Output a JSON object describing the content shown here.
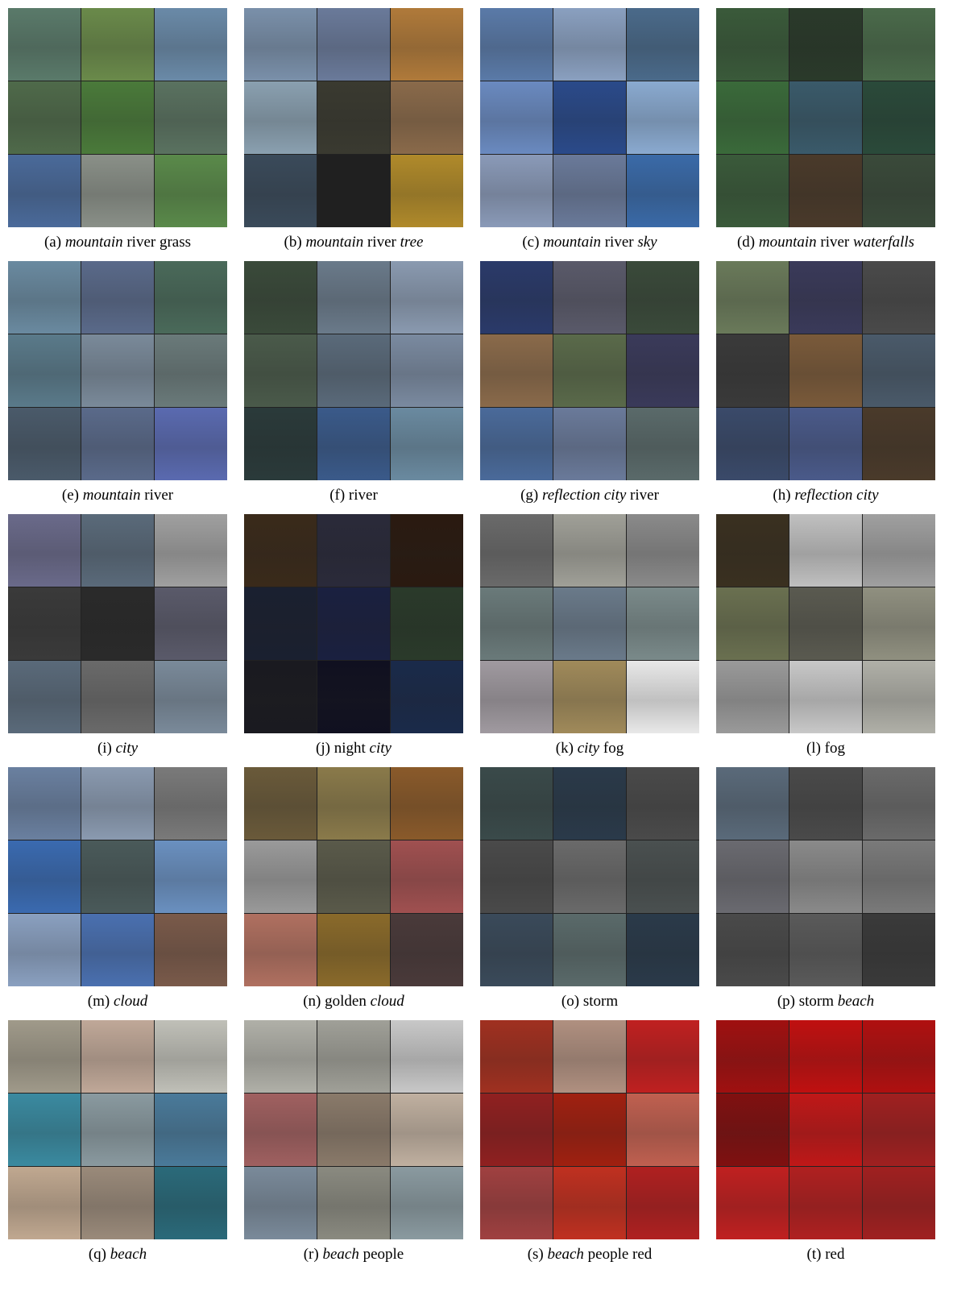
{
  "panels": [
    {
      "label": "(a)",
      "parts": [
        {
          "t": "mountain",
          "i": true
        },
        {
          "t": "river grass",
          "i": false
        }
      ],
      "tiles": [
        "#5a7a6a",
        "#6a8a4a",
        "#6a8aa8",
        "#4f6a4a",
        "#4a7a3a",
        "#5a7260",
        "#4a6a9a",
        "#8a9088",
        "#5a8a4a"
      ]
    },
    {
      "label": "(b)",
      "parts": [
        {
          "t": "mountain",
          "i": true
        },
        {
          "t": "river",
          "i": false
        },
        {
          "t": "tree",
          "i": true
        }
      ],
      "tiles": [
        "#7a90aa",
        "#6a7a9a",
        "#b07a3a",
        "#8aa0b0",
        "#3a3a30",
        "#8a6a4a",
        "#3a4a5a",
        "#202020",
        "#b08a2a"
      ]
    },
    {
      "label": "(c)",
      "parts": [
        {
          "t": "mountain",
          "i": true
        },
        {
          "t": "river",
          "i": false
        },
        {
          "t": "sky",
          "i": true
        }
      ],
      "tiles": [
        "#5a7aa8",
        "#8aa0c0",
        "#4a6a8a",
        "#6a8ac0",
        "#2a4a8a",
        "#8aaad0",
        "#8a9ab8",
        "#6a7a9a",
        "#3a6aa8"
      ]
    },
    {
      "label": "(d)",
      "parts": [
        {
          "t": "mountain",
          "i": true
        },
        {
          "t": "river",
          "i": false
        },
        {
          "t": "waterfalls",
          "i": true
        }
      ],
      "tiles": [
        "#3a5a3a",
        "#2a3a2a",
        "#4a6a4a",
        "#3a6a3a",
        "#3a5a6a",
        "#2a4a3a",
        "#3a5a3a",
        "#4a3a2a",
        "#3a4a3a"
      ]
    },
    {
      "label": "(e)",
      "parts": [
        {
          "t": "mountain",
          "i": true
        },
        {
          "t": "river",
          "i": false
        }
      ],
      "tiles": [
        "#6a8aa0",
        "#5a6a8a",
        "#4a6a5a",
        "#5a7a8a",
        "#7a8a9a",
        "#6a7a7a",
        "#4a5a6a",
        "#5a6a8a",
        "#5a6ab0"
      ]
    },
    {
      "label": "(f)",
      "parts": [
        {
          "t": "river",
          "i": false
        }
      ],
      "tiles": [
        "#3a4a3a",
        "#6a7a8a",
        "#8a9ab0",
        "#4a5a4a",
        "#5a6a7a",
        "#7a8aa0",
        "#2a3a3a",
        "#3a5a8a",
        "#6a8aa0"
      ]
    },
    {
      "label": "(g)",
      "parts": [
        {
          "t": "reflection city",
          "i": true
        },
        {
          "t": "river",
          "i": false
        }
      ],
      "tiles": [
        "#2a3a6a",
        "#5a5a6a",
        "#3a4a3a",
        "#8a6a4a",
        "#5a6a4a",
        "#3a3a5a",
        "#4a6a9a",
        "#6a7a9a",
        "#5a6a6a"
      ]
    },
    {
      "label": "(h)",
      "parts": [
        {
          "t": "reflection city",
          "i": true
        }
      ],
      "tiles": [
        "#6a7a5a",
        "#3a3a5a",
        "#4a4a4a",
        "#3a3a3a",
        "#7a5a3a",
        "#4a5a6a",
        "#3a4a6a",
        "#4a5a8a",
        "#4a3a2a"
      ]
    },
    {
      "label": "(i)",
      "parts": [
        {
          "t": "city",
          "i": true
        }
      ],
      "tiles": [
        "#6a6a8a",
        "#5a6a7a",
        "#a0a0a0",
        "#3a3a3a",
        "#2a2a2a",
        "#5a5a6a",
        "#5a6a7a",
        "#6a6a6a",
        "#7a8a9a"
      ]
    },
    {
      "label": "(j)",
      "parts": [
        {
          "t": "night",
          "i": false
        },
        {
          "t": "city",
          "i": true
        }
      ],
      "tiles": [
        "#3a2a1a",
        "#2a2a3a",
        "#2a1a10",
        "#1a2030",
        "#1a2040",
        "#2a3a2a",
        "#1a1a20",
        "#101020",
        "#1a2a4a"
      ]
    },
    {
      "label": "(k)",
      "parts": [
        {
          "t": "city",
          "i": true
        },
        {
          "t": "fog",
          "i": false
        }
      ],
      "tiles": [
        "#6a6a6a",
        "#a0a098",
        "#8a8a8a",
        "#6a7a7a",
        "#6a7a8a",
        "#7a8a8a",
        "#a09aa0",
        "#a08a5a",
        "#e8e8e8"
      ]
    },
    {
      "label": "(l)",
      "parts": [
        {
          "t": "fog",
          "i": false
        }
      ],
      "tiles": [
        "#3a3020",
        "#c0c0c0",
        "#a0a0a0",
        "#6a7050",
        "#5a5a50",
        "#909080",
        "#9a9a9a",
        "#c8c8c8",
        "#b0b0a8"
      ]
    },
    {
      "label": "(m)",
      "parts": [
        {
          "t": "cloud",
          "i": true
        }
      ],
      "tiles": [
        "#6a80a0",
        "#8a9ab0",
        "#7a7a7a",
        "#3a6ab0",
        "#4a5a5a",
        "#6a90c0",
        "#8aa0c0",
        "#4a70b0",
        "#7a5a4a"
      ]
    },
    {
      "label": "(n)",
      "parts": [
        {
          "t": "golden",
          "i": false
        },
        {
          "t": "cloud",
          "i": true
        }
      ],
      "tiles": [
        "#6a5a3a",
        "#8a7a4a",
        "#8a5a2a",
        "#9a9a9a",
        "#5a5a4a",
        "#a05050",
        "#b07060",
        "#8a6a2a",
        "#4a3a3a"
      ]
    },
    {
      "label": "(o)",
      "parts": [
        {
          "t": "storm",
          "i": false
        }
      ],
      "tiles": [
        "#3a4a4a",
        "#2a3a4a",
        "#4a4a4a",
        "#4a4a4a",
        "#6a6a6a",
        "#4a5050",
        "#3a4a5a",
        "#5a6a6a",
        "#2a3a4a"
      ]
    },
    {
      "label": "(p)",
      "parts": [
        {
          "t": "storm",
          "i": false
        },
        {
          "t": "beach",
          "i": true
        }
      ],
      "tiles": [
        "#5a6a7a",
        "#4a4a4a",
        "#6a6a6a",
        "#6a6a70",
        "#8a8a8a",
        "#7a7a7a",
        "#4a4a4a",
        "#5a5a5a",
        "#3a3a3a"
      ]
    },
    {
      "label": "(q)",
      "parts": [
        {
          "t": "beach",
          "i": true
        }
      ],
      "tiles": [
        "#a09a8a",
        "#c0a898",
        "#c0c0b8",
        "#3a8aa0",
        "#8a9aa0",
        "#4a7a9a",
        "#c0a890",
        "#9a8a7a",
        "#2a6a7a"
      ]
    },
    {
      "label": "(r)",
      "parts": [
        {
          "t": "beach",
          "i": true
        },
        {
          "t": "people",
          "i": false
        }
      ],
      "tiles": [
        "#b0b0a8",
        "#a0a098",
        "#c8c8c8",
        "#a06060",
        "#8a7a6a",
        "#c0b0a0",
        "#7a8a9a",
        "#8a8a80",
        "#8a9aa0"
      ]
    },
    {
      "label": "(s)",
      "parts": [
        {
          "t": "beach",
          "i": true
        },
        {
          "t": "people red",
          "i": false
        }
      ],
      "tiles": [
        "#a03020",
        "#b09080",
        "#c02020",
        "#902020",
        "#a02010",
        "#c06050",
        "#a04040",
        "#c03020",
        "#b02020"
      ]
    },
    {
      "label": "(t)",
      "parts": [
        {
          "t": "red",
          "i": false
        }
      ],
      "tiles": [
        "#a01010",
        "#c01010",
        "#b01010",
        "#801010",
        "#c01818",
        "#a02020",
        "#c02020",
        "#b02020",
        "#a02020"
      ]
    }
  ]
}
